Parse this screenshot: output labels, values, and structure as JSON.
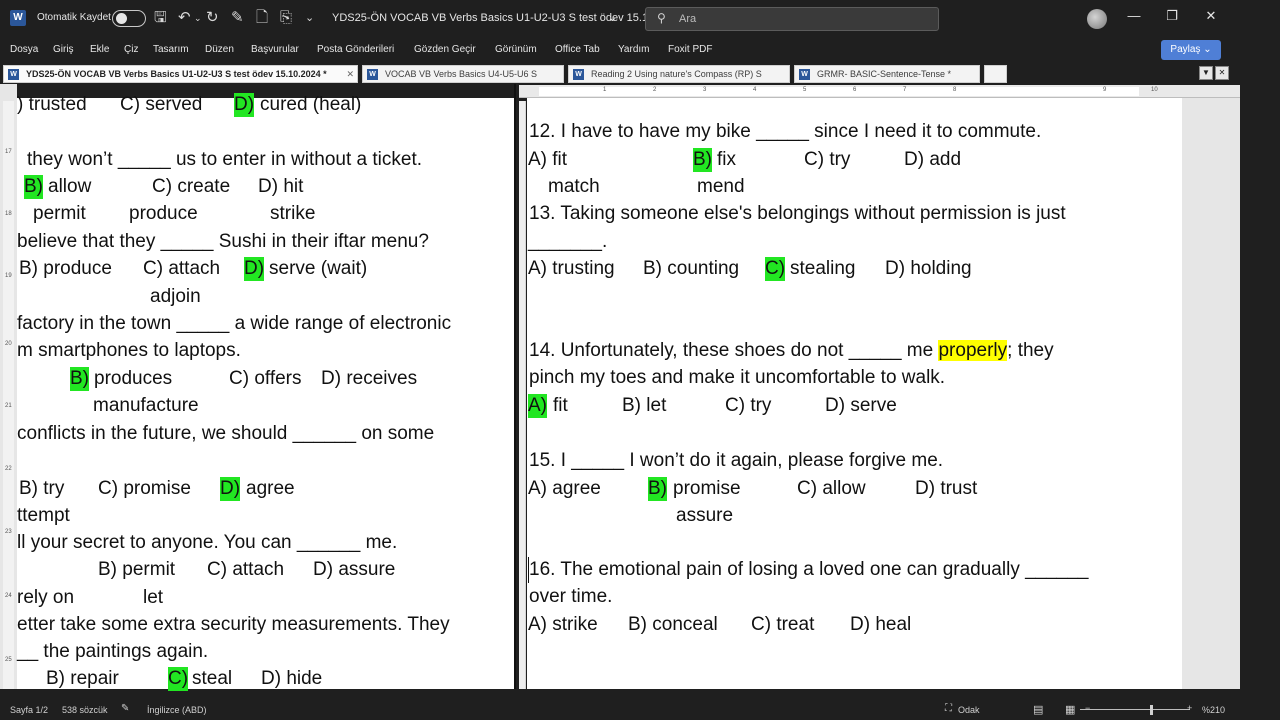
{
  "titlebar": {
    "app_letter": "W",
    "autosave_label": "Otomatik Kaydet",
    "doc_title": "YDS25-ÖN VOCAB VB Verbs Basics U1-U2-U3 S test ödev 15.10....",
    "search_placeholder": "Ara"
  },
  "menu": [
    "Dosya",
    "Giriş",
    "Ekle",
    "Çiz",
    "Tasarım",
    "Düzen",
    "Başvurular",
    "Posta Gönderileri",
    "Gözden Geçir",
    "Görünüm",
    "Office Tab",
    "Yardım",
    "Foxit PDF"
  ],
  "share_label": "Paylaş",
  "doc_tabs": [
    {
      "label": "YDS25-ÖN VOCAB VB Verbs Basics U1-U2-U3 S test ödev 15.10.2024 *",
      "active": true
    },
    {
      "label": "VOCAB VB Verbs Basics U4-U5-U6 S",
      "active": false
    },
    {
      "label": "Reading 2 Using nature's Compass (RP) S",
      "active": false
    },
    {
      "label": "GRMR- BASIC-Sentence-Tense *",
      "active": false
    }
  ],
  "ruler_numbers": [
    "1",
    "2",
    "3",
    "4",
    "5",
    "6",
    "7",
    "8",
    "9",
    "10"
  ],
  "left_ruler_numbers": [
    "17",
    "18",
    "19",
    "20",
    "21",
    "22",
    "23",
    "24",
    "25"
  ],
  "left_page": {
    "l1": {
      "a": ") trusted",
      "b": "C) served",
      "c": "D)",
      "d": "cured (heal)"
    },
    "l2": "they won’t _____ us to enter in without a ticket.",
    "l3": {
      "a": "B)",
      "b": "allow",
      "c": "C) create",
      "d": "D) hit"
    },
    "l4": {
      "a": "permit",
      "b": "produce",
      "c": "strike"
    },
    "l5": "believe that they _____ Sushi in their iftar menu?",
    "l6": {
      "a": "B) produce",
      "b": "C) attach",
      "c": "D)",
      "d": "serve (wait)"
    },
    "l7": "adjoin",
    "l8": "factory in the town _____ a wide range of electronic",
    "l9": "m smartphones to laptops.",
    "l10": {
      "a": "B)",
      "b": "produces",
      "c": "C) offers",
      "d": "D) receives"
    },
    "l11": "manufacture",
    "l12": "conflicts in the future, we should ______ on some",
    "l13": {
      "a": "B) try",
      "b": "C) promise",
      "c": "D)",
      "d": "agree"
    },
    "l14": "ttempt",
    "l15": "ll your secret to anyone. You can ______ me.",
    "l16": {
      "a": "B) permit",
      "b": "C) attach",
      "c": "D) assure"
    },
    "l17": {
      "a": "rely on",
      "b": "let"
    },
    "l18": "etter take some extra security measurements. They",
    "l19": "__ the paintings again.",
    "l20": {
      "a": "B) repair",
      "b": "C)",
      "c": "steal",
      "d": "D) hide"
    }
  },
  "right_page": {
    "q12": "12. I have to have my bike _____ since I need it to commute.",
    "q12_opts": {
      "a": "A) fit",
      "b": "B)",
      "c": "fix",
      "d": "C) try",
      "e": "D) add"
    },
    "q12_extra": {
      "a": "match",
      "b": "mend"
    },
    "q13": "13. Taking someone else's belongings without permission is just",
    "q13_cont": "_______.",
    "q13_opts": {
      "a": "A) trusting",
      "b": "B) counting",
      "c": "C)",
      "d": "stealing",
      "e": "D) holding"
    },
    "q14_pre": "14. Unfortunately, these shoes do not _____ me",
    "q14_hl": "properly",
    "q14_post": "; they",
    "q14_cont": "pinch my toes and make it uncomfortable to walk.",
    "q14_opts": {
      "a": "A)",
      "b": "fit",
      "c": "B) let",
      "d": "C) try",
      "e": "D) serve"
    },
    "q15": "15. I _____ I won’t do it again, please forgive me.",
    "q15_opts": {
      "a": "A) agree",
      "b": "B)",
      "c": "promise",
      "d": "C) allow",
      "e": "D) trust"
    },
    "q15_extra": "assure",
    "q16": "16. The emotional pain of losing a loved one can gradually ______",
    "q16_cont": "over time.",
    "q16_opts": {
      "a": "A) strike",
      "b": "B) conceal",
      "c": "C) treat",
      "d": "D) heal"
    }
  },
  "status": {
    "page": "Sayfa 1/2",
    "words": "538 sözcük",
    "language": "İngilizce (ABD)",
    "focus": "Odak",
    "zoom": "%210"
  },
  "colors": {
    "highlight_green": "#22e622",
    "highlight_yellow": "#ffff00",
    "share_button": "#4f7fd6"
  }
}
